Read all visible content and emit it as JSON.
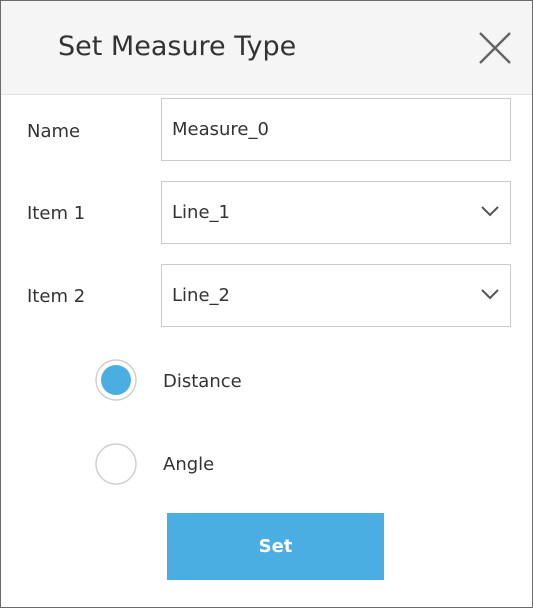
{
  "dialog": {
    "title": "Set Measure Type"
  },
  "form": {
    "name_label": "Name",
    "name_value": "Measure_0",
    "item1_label": "Item 1",
    "item1_value": "Line_1",
    "item2_label": "Item 2",
    "item2_value": "Line_2"
  },
  "measure_type": {
    "options": [
      {
        "label": "Distance",
        "selected": true
      },
      {
        "label": "Angle",
        "selected": false
      }
    ]
  },
  "actions": {
    "set_label": "Set"
  },
  "colors": {
    "accent": "#4aaee3",
    "header_bg": "#f5f5f5",
    "text": "#333333",
    "border": "#cccccc"
  },
  "icons": {
    "close": "close-icon",
    "dropdown": "chevron-down-icon"
  }
}
